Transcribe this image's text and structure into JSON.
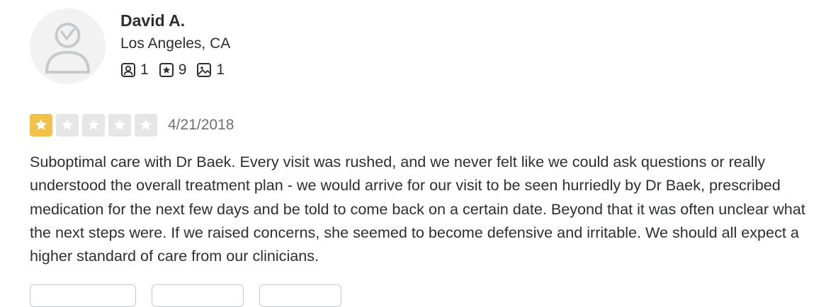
{
  "user": {
    "name": "David A.",
    "location": "Los Angeles, CA",
    "stats": {
      "friends": "1",
      "reviews": "9",
      "photos": "1"
    }
  },
  "review": {
    "rating": 1,
    "max_rating": 5,
    "date": "4/21/2018",
    "text": "Suboptimal care with Dr Baek. Every visit was rushed, and we never felt like we could ask questions or really understood the overall treatment plan - we would arrive for our visit to be seen hurriedly by Dr Baek, prescribed medication for the next few days and be told to come back on a certain date. Beyond that it was often unclear what the next steps were. If we raised concerns, she seemed to become defensive and irritable. We should all expect a higher standard of care from our clinicians."
  },
  "colors": {
    "star_filled": "#f2c14a",
    "star_empty": "#e6e6e6",
    "text": "#2d2e2f",
    "muted": "#6e7072"
  },
  "icons": {
    "friends": "friends-icon",
    "reviews": "review-star-icon",
    "photos": "photo-icon",
    "star": "star-icon"
  }
}
